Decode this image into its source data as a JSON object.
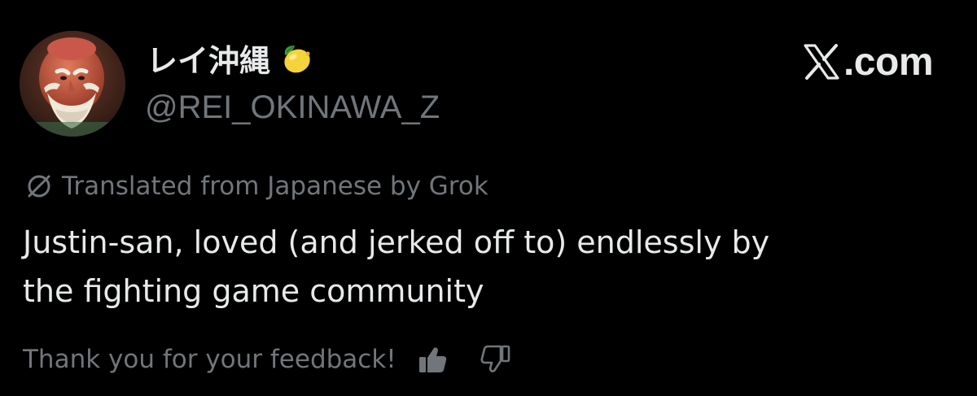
{
  "author": {
    "display_name": "レイ沖縄",
    "emoji": "lemon-icon",
    "handle": "@REI_OKINAWA_Z",
    "avatar": "avatar-portrait"
  },
  "brand": {
    "logo": "x-logo-icon",
    "text": ".com"
  },
  "translation": {
    "icon": "translate-icon",
    "label": "Translated from Japanese by Grok"
  },
  "post": {
    "lines": [
      "Justin-san, loved (and jerked off to) endlessly by",
      "the fighting game community"
    ]
  },
  "feedback": {
    "label": "Thank you for your feedback!",
    "up_icon": "thumbs-up-icon",
    "down_icon": "thumbs-down-icon"
  },
  "colors": {
    "background": "#000000",
    "primary_text": "#e7e9ea",
    "secondary_text": "#71767b"
  }
}
